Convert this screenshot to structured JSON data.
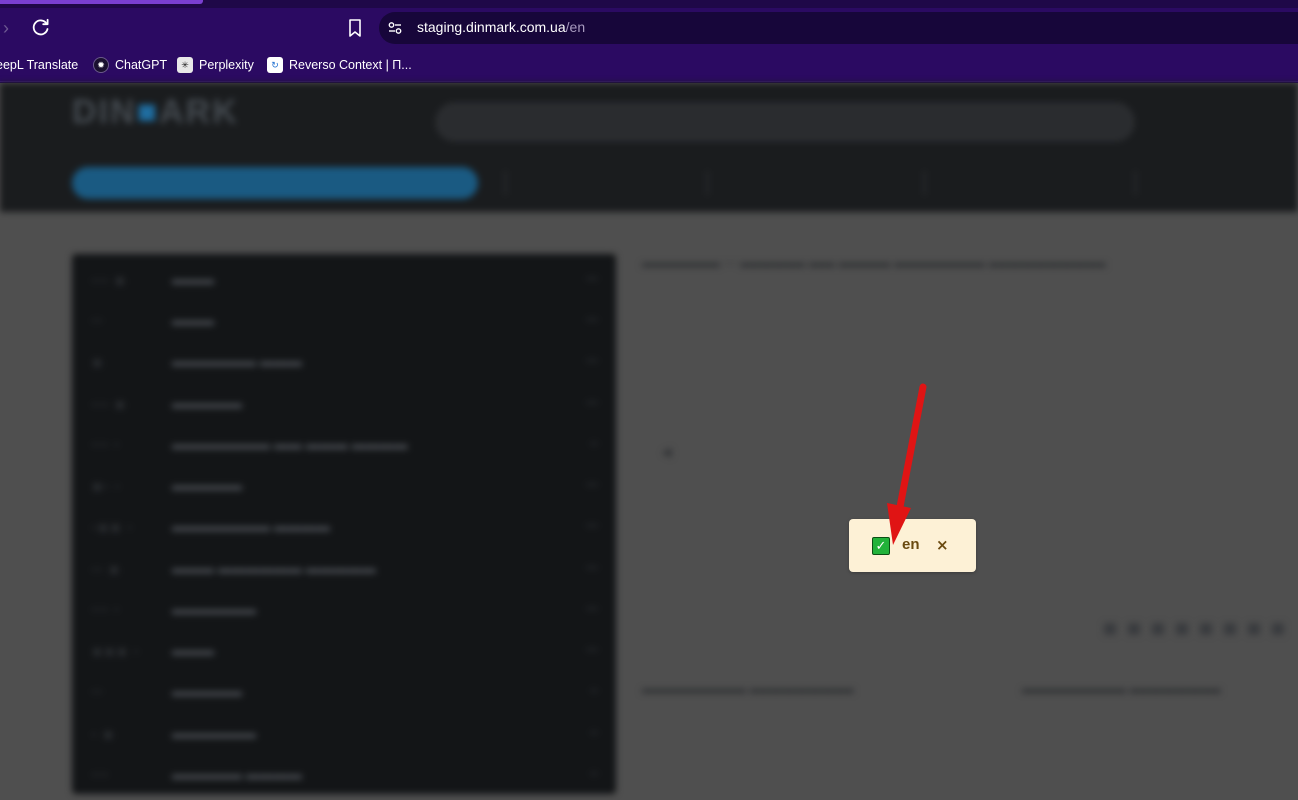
{
  "browser": {
    "url_host": "staging.dinmark.com.ua",
    "url_path": "/en",
    "bookmarks": [
      {
        "label": "eepL Translate",
        "icon": "deepl-icon"
      },
      {
        "label": "ChatGPT",
        "icon": "chatgpt-icon"
      },
      {
        "label": "Perplexity",
        "icon": "perplexity-icon"
      },
      {
        "label": "Reverso Context | П...",
        "icon": "reverso-icon"
      }
    ]
  },
  "popup": {
    "language": "en",
    "checked": true,
    "close_glyph": "×"
  },
  "annotation": {
    "arrow_color": "#e01414"
  }
}
